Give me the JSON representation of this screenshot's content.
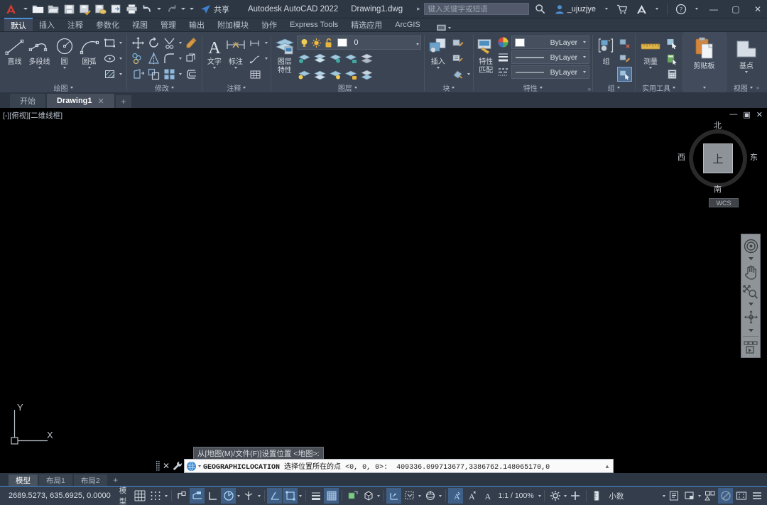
{
  "window": {
    "app_title": "Autodesk AutoCAD 2022",
    "document_name": "Drawing1.dwg",
    "minimize": "—",
    "maximize": "▢",
    "close": "✕"
  },
  "quick_access": {
    "items": [
      {
        "name": "new-file",
        "label": "新建"
      },
      {
        "name": "open-file",
        "label": "打开"
      },
      {
        "name": "save-file",
        "label": "保存"
      },
      {
        "name": "save-as",
        "label": "另存为"
      },
      {
        "name": "cloud-save",
        "label": "保存到 Web 和 Mobile"
      },
      {
        "name": "open-from-web",
        "label": "从 Web 和 Mobile 打开"
      },
      {
        "name": "plot",
        "label": "打印"
      },
      {
        "name": "undo",
        "label": "放弃"
      },
      {
        "name": "redo",
        "label": "重做"
      }
    ],
    "share_label": "共享"
  },
  "search": {
    "placeholder": "键入关键字或短语",
    "user": "_ujuzjye"
  },
  "ribbon_tabs": [
    {
      "label": "默认",
      "active": true
    },
    {
      "label": "插入",
      "active": false
    },
    {
      "label": "注释",
      "active": false
    },
    {
      "label": "参数化",
      "active": false
    },
    {
      "label": "视图",
      "active": false
    },
    {
      "label": "管理",
      "active": false
    },
    {
      "label": "输出",
      "active": false
    },
    {
      "label": "附加模块",
      "active": false
    },
    {
      "label": "协作",
      "active": false
    },
    {
      "label": "Express Tools",
      "active": false
    },
    {
      "label": "精选应用",
      "active": false
    },
    {
      "label": "ArcGIS",
      "active": false
    }
  ],
  "ribbon": {
    "draw": {
      "title": "绘图",
      "line": "直线",
      "polyline": "多段线",
      "circle": "圆",
      "arc": "圆弧",
      "rectangle": "矩形",
      "ellipse": "椭圆",
      "hatch": "图案填充"
    },
    "modify": {
      "title": "修改",
      "move": "移动",
      "rotate": "旋转",
      "trim": "修剪",
      "erase": "删除",
      "copy": "复制",
      "mirror": "镜像",
      "fillet": "圆角",
      "explode": "分解",
      "stretch": "拉伸",
      "scale": "缩放",
      "array": "阵列",
      "offset": "偏移"
    },
    "annotation": {
      "title": "注释",
      "text": "文字",
      "dimension": "标注",
      "leader": "引线",
      "table": "表格"
    },
    "layers": {
      "title": "图层",
      "layer_properties_l1": "图层",
      "layer_properties_l2": "特性",
      "current_layer": "0"
    },
    "block": {
      "title": "块",
      "insert": "插入"
    },
    "properties": {
      "title": "特性",
      "match_l1": "特性",
      "match_l2": "匹配",
      "color": "ByLayer",
      "lineweight": "ByLayer",
      "linetype": "ByLayer"
    },
    "groups": {
      "title": "组",
      "group": "组"
    },
    "utilities": {
      "title": "实用工具",
      "measure": "测量"
    },
    "clipboard": {
      "title": "剪贴板",
      "paste": "剪贴板"
    },
    "view": {
      "title": "视图",
      "base": "基点"
    }
  },
  "doc_tabs": [
    {
      "label": "开始",
      "active": false,
      "closable": false
    },
    {
      "label": "Drawing1",
      "active": true,
      "closable": true
    }
  ],
  "doc_tabs_add": "+",
  "viewport": {
    "label": "[-][俯视][二维线框]",
    "min": "—",
    "restore": "▣",
    "close": "✕"
  },
  "viewcube": {
    "north": "北",
    "south": "南",
    "east": "东",
    "west": "西",
    "top": "上",
    "ucs_label": "WCS"
  },
  "navbar": {
    "items": [
      {
        "name": "steering-wheel-icon",
        "label": "全导航控制盘"
      },
      {
        "name": "pan-icon",
        "label": "平移"
      },
      {
        "name": "zoom-icon",
        "label": "缩放"
      },
      {
        "name": "orbit-icon",
        "label": "动态观察"
      },
      {
        "name": "showmotion-icon",
        "label": "ShowMotion"
      }
    ]
  },
  "ucs_icon": {
    "x": "X",
    "y": "Y"
  },
  "dynamic_prompt": "从[地图(M)/文件(F)]设置位置 <地图>:",
  "command_line": {
    "command": "GEOGRAPHICLOCATION",
    "prompt": "选择位置所在的点",
    "default": "<0, 0, 0>:",
    "input": "409336.099713677,3386762.148065170,0",
    "close_glyph": "✕"
  },
  "layout_tabs": [
    {
      "label": "模型",
      "active": true
    },
    {
      "label": "布局1",
      "active": false
    },
    {
      "label": "布局2",
      "active": false
    }
  ],
  "layout_tabs_add": "+",
  "status_bar": {
    "coordinates": "2689.5273, 635.6925, 0.0000",
    "model_label": "模型",
    "scale": "1:1 / 100%",
    "units": "小数",
    "items": [
      {
        "name": "grid-toggle",
        "label": "栅格"
      },
      {
        "name": "snap-toggle",
        "label": "捕捉模式"
      },
      {
        "name": "infer-constraints",
        "label": "推断约束"
      },
      {
        "name": "dynamic-input",
        "label": "动态输入"
      },
      {
        "name": "ortho-mode",
        "label": "正交模式"
      },
      {
        "name": "polar-tracking",
        "label": "极轴追踪"
      },
      {
        "name": "isometric-draft",
        "label": "等轴测草图"
      },
      {
        "name": "object-snap-tracking",
        "label": "对象捕捉追踪"
      },
      {
        "name": "object-snap",
        "label": "对象捕捉"
      },
      {
        "name": "lineweight",
        "label": "显示/隐藏线宽"
      },
      {
        "name": "transparency",
        "label": "显示/隐藏透明度"
      },
      {
        "name": "selection-cycling",
        "label": "选择循环"
      },
      {
        "name": "3d-object-snap",
        "label": "三维对象捕捉"
      },
      {
        "name": "dynamic-ucs",
        "label": "动态 UCS"
      },
      {
        "name": "selection-filtering",
        "label": "选择过滤"
      },
      {
        "name": "gizmo",
        "label": "小控件"
      },
      {
        "name": "annotation-visibility",
        "label": "注释可见性"
      },
      {
        "name": "auto-scale",
        "label": "自动缩放"
      },
      {
        "name": "workspace-switching",
        "label": "切换工作空间"
      },
      {
        "name": "annotation-monitor",
        "label": "注释监视器"
      },
      {
        "name": "isolate-objects",
        "label": "隔离对象"
      },
      {
        "name": "hardware-acceleration",
        "label": "硬件加速"
      },
      {
        "name": "clean-screen",
        "label": "全屏显示"
      },
      {
        "name": "customization",
        "label": "自定义"
      }
    ]
  },
  "colors": {
    "accent": "#4a90d9",
    "ribbon_bg": "#3b4453",
    "titlebar_bg": "#2d3643",
    "canvas_bg": "#000000",
    "logo_red": "#d33b30"
  }
}
